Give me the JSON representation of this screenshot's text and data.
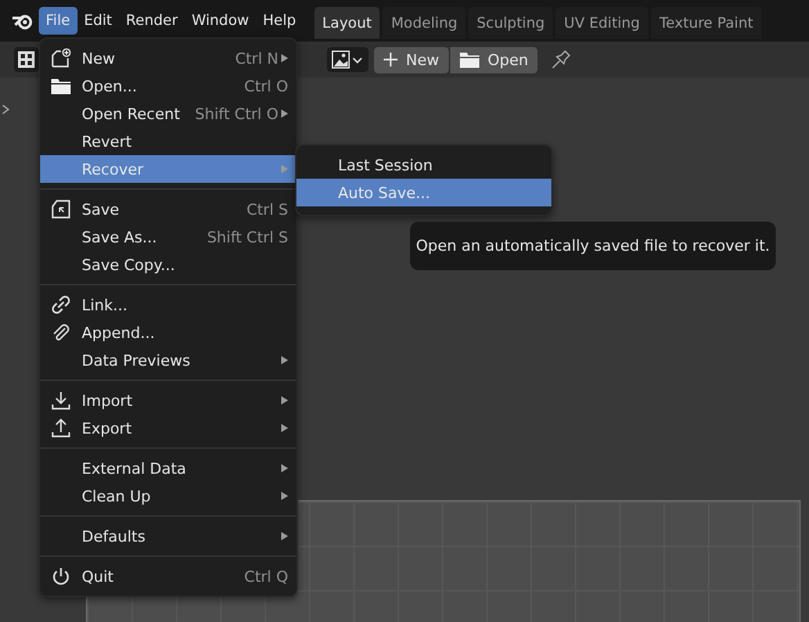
{
  "menubar": [
    {
      "label": "File",
      "selected": true
    },
    {
      "label": "Edit",
      "selected": false
    },
    {
      "label": "Render",
      "selected": false
    },
    {
      "label": "Window",
      "selected": false
    },
    {
      "label": "Help",
      "selected": false
    }
  ],
  "workspace_tabs": [
    {
      "label": "Layout",
      "selected": true
    },
    {
      "label": "Modeling",
      "selected": false
    },
    {
      "label": "Sculpting",
      "selected": false
    },
    {
      "label": "UV Editing",
      "selected": false
    },
    {
      "label": "Texture Paint",
      "selected": false
    }
  ],
  "header": {
    "new_button": "New",
    "open_button": "Open"
  },
  "file_menu": [
    [
      {
        "label": "New",
        "shortcut": "Ctrl N",
        "submenu": true,
        "selected": false
      },
      {
        "label": "Open...",
        "shortcut": "Ctrl O",
        "submenu": false,
        "selected": false
      },
      {
        "label": "Open Recent",
        "shortcut": "Shift Ctrl O",
        "submenu": true,
        "selected": false
      },
      {
        "label": "Revert",
        "submenu": false,
        "selected": false
      },
      {
        "label": "Recover",
        "submenu": true,
        "selected": true
      }
    ],
    [
      {
        "label": "Save",
        "shortcut": "Ctrl S",
        "submenu": false,
        "selected": false
      },
      {
        "label": "Save As...",
        "shortcut": "Shift Ctrl S",
        "submenu": false,
        "selected": false
      },
      {
        "label": "Save Copy...",
        "submenu": false,
        "selected": false
      }
    ],
    [
      {
        "label": "Link...",
        "submenu": false,
        "selected": false
      },
      {
        "label": "Append...",
        "submenu": false,
        "selected": false
      },
      {
        "label": "Data Previews",
        "submenu": true,
        "selected": false
      }
    ],
    [
      {
        "label": "Import",
        "submenu": true,
        "selected": false
      },
      {
        "label": "Export",
        "submenu": true,
        "selected": false
      }
    ],
    [
      {
        "label": "External Data",
        "submenu": true,
        "selected": false
      },
      {
        "label": "Clean Up",
        "submenu": true,
        "selected": false
      }
    ],
    [
      {
        "label": "Defaults",
        "submenu": true,
        "selected": false
      }
    ],
    [
      {
        "label": "Quit",
        "shortcut": "Ctrl Q",
        "submenu": false,
        "selected": false
      }
    ]
  ],
  "recover_submenu": [
    {
      "label": "Last Session",
      "selected": false
    },
    {
      "label": "Auto Save...",
      "selected": true
    }
  ],
  "tooltip": "Open an automatically saved file to recover it."
}
